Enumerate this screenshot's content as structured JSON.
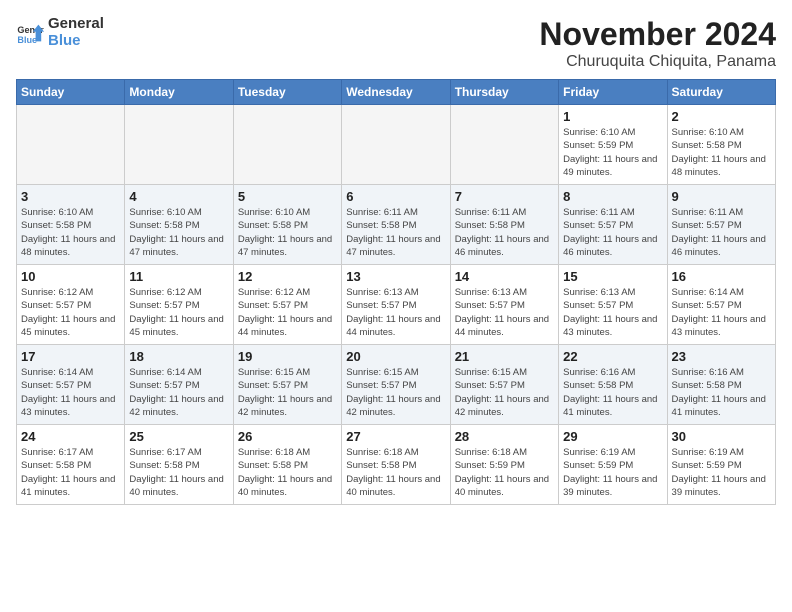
{
  "logo": {
    "line1": "General",
    "line2": "Blue"
  },
  "title": "November 2024",
  "location": "Churuquita Chiquita, Panama",
  "weekdays": [
    "Sunday",
    "Monday",
    "Tuesday",
    "Wednesday",
    "Thursday",
    "Friday",
    "Saturday"
  ],
  "weeks": [
    [
      {
        "day": "",
        "info": ""
      },
      {
        "day": "",
        "info": ""
      },
      {
        "day": "",
        "info": ""
      },
      {
        "day": "",
        "info": ""
      },
      {
        "day": "",
        "info": ""
      },
      {
        "day": "1",
        "info": "Sunrise: 6:10 AM\nSunset: 5:59 PM\nDaylight: 11 hours and 49 minutes."
      },
      {
        "day": "2",
        "info": "Sunrise: 6:10 AM\nSunset: 5:58 PM\nDaylight: 11 hours and 48 minutes."
      }
    ],
    [
      {
        "day": "3",
        "info": "Sunrise: 6:10 AM\nSunset: 5:58 PM\nDaylight: 11 hours and 48 minutes."
      },
      {
        "day": "4",
        "info": "Sunrise: 6:10 AM\nSunset: 5:58 PM\nDaylight: 11 hours and 47 minutes."
      },
      {
        "day": "5",
        "info": "Sunrise: 6:10 AM\nSunset: 5:58 PM\nDaylight: 11 hours and 47 minutes."
      },
      {
        "day": "6",
        "info": "Sunrise: 6:11 AM\nSunset: 5:58 PM\nDaylight: 11 hours and 47 minutes."
      },
      {
        "day": "7",
        "info": "Sunrise: 6:11 AM\nSunset: 5:58 PM\nDaylight: 11 hours and 46 minutes."
      },
      {
        "day": "8",
        "info": "Sunrise: 6:11 AM\nSunset: 5:57 PM\nDaylight: 11 hours and 46 minutes."
      },
      {
        "day": "9",
        "info": "Sunrise: 6:11 AM\nSunset: 5:57 PM\nDaylight: 11 hours and 46 minutes."
      }
    ],
    [
      {
        "day": "10",
        "info": "Sunrise: 6:12 AM\nSunset: 5:57 PM\nDaylight: 11 hours and 45 minutes."
      },
      {
        "day": "11",
        "info": "Sunrise: 6:12 AM\nSunset: 5:57 PM\nDaylight: 11 hours and 45 minutes."
      },
      {
        "day": "12",
        "info": "Sunrise: 6:12 AM\nSunset: 5:57 PM\nDaylight: 11 hours and 44 minutes."
      },
      {
        "day": "13",
        "info": "Sunrise: 6:13 AM\nSunset: 5:57 PM\nDaylight: 11 hours and 44 minutes."
      },
      {
        "day": "14",
        "info": "Sunrise: 6:13 AM\nSunset: 5:57 PM\nDaylight: 11 hours and 44 minutes."
      },
      {
        "day": "15",
        "info": "Sunrise: 6:13 AM\nSunset: 5:57 PM\nDaylight: 11 hours and 43 minutes."
      },
      {
        "day": "16",
        "info": "Sunrise: 6:14 AM\nSunset: 5:57 PM\nDaylight: 11 hours and 43 minutes."
      }
    ],
    [
      {
        "day": "17",
        "info": "Sunrise: 6:14 AM\nSunset: 5:57 PM\nDaylight: 11 hours and 43 minutes."
      },
      {
        "day": "18",
        "info": "Sunrise: 6:14 AM\nSunset: 5:57 PM\nDaylight: 11 hours and 42 minutes."
      },
      {
        "day": "19",
        "info": "Sunrise: 6:15 AM\nSunset: 5:57 PM\nDaylight: 11 hours and 42 minutes."
      },
      {
        "day": "20",
        "info": "Sunrise: 6:15 AM\nSunset: 5:57 PM\nDaylight: 11 hours and 42 minutes."
      },
      {
        "day": "21",
        "info": "Sunrise: 6:15 AM\nSunset: 5:57 PM\nDaylight: 11 hours and 42 minutes."
      },
      {
        "day": "22",
        "info": "Sunrise: 6:16 AM\nSunset: 5:58 PM\nDaylight: 11 hours and 41 minutes."
      },
      {
        "day": "23",
        "info": "Sunrise: 6:16 AM\nSunset: 5:58 PM\nDaylight: 11 hours and 41 minutes."
      }
    ],
    [
      {
        "day": "24",
        "info": "Sunrise: 6:17 AM\nSunset: 5:58 PM\nDaylight: 11 hours and 41 minutes."
      },
      {
        "day": "25",
        "info": "Sunrise: 6:17 AM\nSunset: 5:58 PM\nDaylight: 11 hours and 40 minutes."
      },
      {
        "day": "26",
        "info": "Sunrise: 6:18 AM\nSunset: 5:58 PM\nDaylight: 11 hours and 40 minutes."
      },
      {
        "day": "27",
        "info": "Sunrise: 6:18 AM\nSunset: 5:58 PM\nDaylight: 11 hours and 40 minutes."
      },
      {
        "day": "28",
        "info": "Sunrise: 6:18 AM\nSunset: 5:59 PM\nDaylight: 11 hours and 40 minutes."
      },
      {
        "day": "29",
        "info": "Sunrise: 6:19 AM\nSunset: 5:59 PM\nDaylight: 11 hours and 39 minutes."
      },
      {
        "day": "30",
        "info": "Sunrise: 6:19 AM\nSunset: 5:59 PM\nDaylight: 11 hours and 39 minutes."
      }
    ]
  ]
}
